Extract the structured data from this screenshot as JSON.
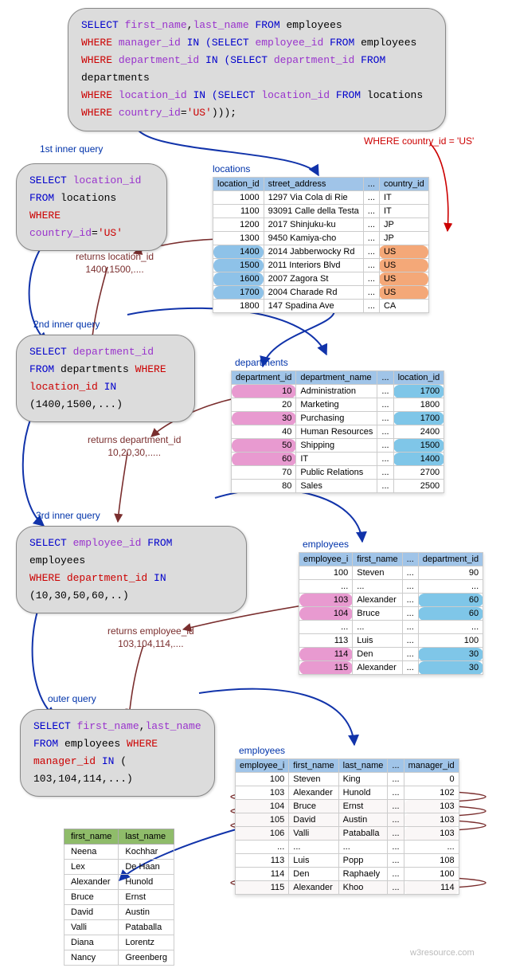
{
  "main_query": {
    "l1_a": "SELECT ",
    "l1_b": "first_name",
    "l1_c": ",",
    "l1_d": "last_name",
    "l1_e": " FROM ",
    "l1_f": "employees",
    "l2_a": "WHERE ",
    "l2_b": "manager_id",
    "l2_c": " IN (",
    "l2_d": "SELECT ",
    "l2_e": "employee_id",
    "l2_f": " FROM ",
    "l2_g": "employees",
    "l3_a": "WHERE ",
    "l3_b": "department_id",
    "l3_c": " IN (",
    "l3_d": "SELECT ",
    "l3_e": "department_id",
    "l3_f": " FROM ",
    "l3_g": "departments",
    "l4_a": "WHERE ",
    "l4_b": "location_id",
    "l4_c": " IN (",
    "l4_d": "SELECT ",
    "l4_e": "location_id",
    "l4_f": " FROM ",
    "l4_g": "locations",
    "l5_a": "WHERE ",
    "l5_b": "country_id",
    "l5_c": "=",
    "l5_d": "'US'",
    "l5_e": ")));"
  },
  "labels": {
    "inner1": "1st inner query",
    "inner2": "2nd inner query",
    "inner3": "3rd inner query",
    "outer": "outer query",
    "locations": "locations",
    "departments": "departments",
    "employees1": "employees",
    "employees2": "employees",
    "where_country": "WHERE country_id = 'US'",
    "ret_loc1": "returns location_id",
    "ret_loc2": "1400,1500,....",
    "ret_dept1": "returns department_id",
    "ret_dept2": "10,20,30,.....",
    "ret_emp1": "returns employee_id",
    "ret_emp2": "103,104,114,....",
    "watermark": "w3resource.com"
  },
  "q1": {
    "a": "SELECT ",
    "b": "location_id",
    "c": "FROM ",
    "d": "locations",
    "e": "WHERE ",
    "f": "country_id",
    "g": "=",
    "h": "'US'"
  },
  "q2": {
    "a": "SELECT ",
    "b": "department_id",
    "c": "FROM ",
    "d": "departments",
    "e": " WHERE",
    "f": "location_id",
    "g": " IN ",
    "h": "(1400,1500,...)"
  },
  "q3": {
    "a": "SELECT ",
    "b": "employee_id",
    "c": " FROM ",
    "d": "employees",
    "e": "WHERE ",
    "f": "department_id",
    "g": " IN ",
    "h": "(10,30,50,60,..)"
  },
  "q4": {
    "a": "SELECT ",
    "b": "first_name",
    "c": ",",
    "d": "last_name",
    "e": "FROM ",
    "f": "employees",
    "g": " WHERE",
    "h": "manager_id",
    "i": " IN ",
    "j": "( 103,104,114,...)"
  },
  "t_locations": {
    "h1": "location_id",
    "h2": "street_address",
    "h3": "country_id",
    "rows": [
      {
        "id": "1000",
        "addr": "1297 Via Cola di Rie",
        "cty": "IT"
      },
      {
        "id": "1100",
        "addr": "93091 Calle della Testa",
        "cty": "IT"
      },
      {
        "id": "1200",
        "addr": "2017 Shinjuku-ku",
        "cty": "JP"
      },
      {
        "id": "1300",
        "addr": "9450 Kamiya-cho",
        "cty": "JP"
      },
      {
        "id": "1400",
        "addr": "2014 Jabberwocky Rd",
        "cty": "US"
      },
      {
        "id": "1500",
        "addr": "2011 Interiors Blvd",
        "cty": "US"
      },
      {
        "id": "1600",
        "addr": "2007 Zagora St",
        "cty": "US"
      },
      {
        "id": "1700",
        "addr": "2004 Charade Rd",
        "cty": "US"
      },
      {
        "id": "1800",
        "addr": "147 Spadina Ave",
        "cty": "CA"
      }
    ]
  },
  "t_departments": {
    "h1": "department_id",
    "h2": "department_name",
    "h3": "location_id",
    "rows": [
      {
        "id": "10",
        "name": "Administration",
        "loc": "1700"
      },
      {
        "id": "20",
        "name": "Marketing",
        "loc": "1800"
      },
      {
        "id": "30",
        "name": "Purchasing",
        "loc": "1700"
      },
      {
        "id": "40",
        "name": "Human Resources",
        "loc": "2400"
      },
      {
        "id": "50",
        "name": "Shipping",
        "loc": "1500"
      },
      {
        "id": "60",
        "name": "IT",
        "loc": "1400"
      },
      {
        "id": "70",
        "name": "Public Relations",
        "loc": "2700"
      },
      {
        "id": "80",
        "name": "Sales",
        "loc": "2500"
      }
    ]
  },
  "t_employees1": {
    "h1": "employee_i",
    "h2": "first_name",
    "h3": "department_id",
    "rows": [
      {
        "id": "100",
        "fn": "Steven",
        "dep": "90"
      },
      {
        "id": "...",
        "fn": "...",
        "dep": "..."
      },
      {
        "id": "103",
        "fn": "Alexander",
        "dep": "60"
      },
      {
        "id": "104",
        "fn": "Bruce",
        "dep": "60"
      },
      {
        "id": "...",
        "fn": "...",
        "dep": "..."
      },
      {
        "id": "113",
        "fn": "Luis",
        "dep": "100"
      },
      {
        "id": "114",
        "fn": "Den",
        "dep": "30"
      },
      {
        "id": "115",
        "fn": "Alexander",
        "dep": "30"
      }
    ]
  },
  "t_employees2": {
    "h1": "employee_i",
    "h2": "first_name",
    "h3": "last_name",
    "h4": "manager_id",
    "rows": [
      {
        "id": "100",
        "fn": "Steven",
        "ln": "King",
        "mgr": "0"
      },
      {
        "id": "103",
        "fn": "Alexander",
        "ln": "Hunold",
        "mgr": "102"
      },
      {
        "id": "104",
        "fn": "Bruce",
        "ln": "Ernst",
        "mgr": "103"
      },
      {
        "id": "105",
        "fn": "David",
        "ln": "Austin",
        "mgr": "103"
      },
      {
        "id": "106",
        "fn": "Valli",
        "ln": "Pataballa",
        "mgr": "103"
      },
      {
        "id": "...",
        "fn": "...",
        "ln": "...",
        "mgr": "..."
      },
      {
        "id": "113",
        "fn": "Luis",
        "ln": "Popp",
        "mgr": "108"
      },
      {
        "id": "114",
        "fn": "Den",
        "ln": "Raphaely",
        "mgr": "100"
      },
      {
        "id": "115",
        "fn": "Alexander",
        "ln": "Khoo",
        "mgr": "114"
      }
    ]
  },
  "t_result": {
    "h1": "first_name",
    "h2": "last_name",
    "rows": [
      {
        "fn": "Neena",
        "ln": "Kochhar"
      },
      {
        "fn": "Lex",
        "ln": "De Haan"
      },
      {
        "fn": "Alexander",
        "ln": "Hunold"
      },
      {
        "fn": "Bruce",
        "ln": "Ernst"
      },
      {
        "fn": "David",
        "ln": "Austin"
      },
      {
        "fn": "Valli",
        "ln": "Pataballa"
      },
      {
        "fn": "Diana",
        "ln": "Lorentz"
      },
      {
        "fn": "Nancy",
        "ln": "Greenberg"
      }
    ]
  }
}
